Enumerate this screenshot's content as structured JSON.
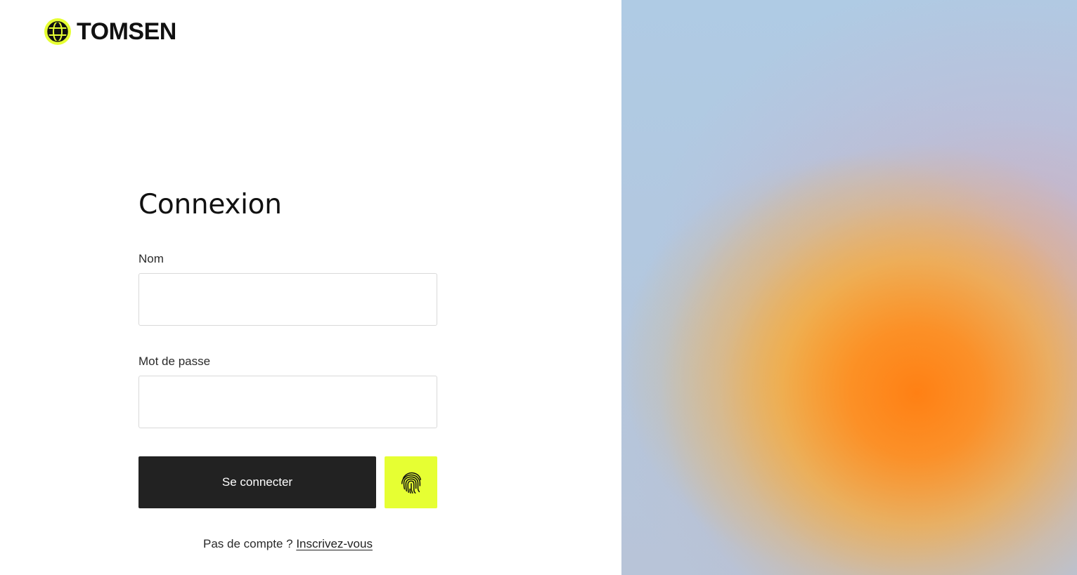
{
  "brand": {
    "name": "TOMSEN",
    "icon": "globe-icon",
    "accent_color": "#e6ff33"
  },
  "login": {
    "title": "Connexion",
    "name_label": "Nom",
    "name_value": "",
    "password_label": "Mot de passe",
    "password_value": "",
    "submit_label": "Se connecter",
    "fingerprint_icon": "fingerprint-icon",
    "no_account_text": "Pas de compte ?",
    "signup_link": "Inscrivez-vous"
  },
  "colors": {
    "button_dark": "#222222",
    "button_accent": "#e6ff33"
  }
}
